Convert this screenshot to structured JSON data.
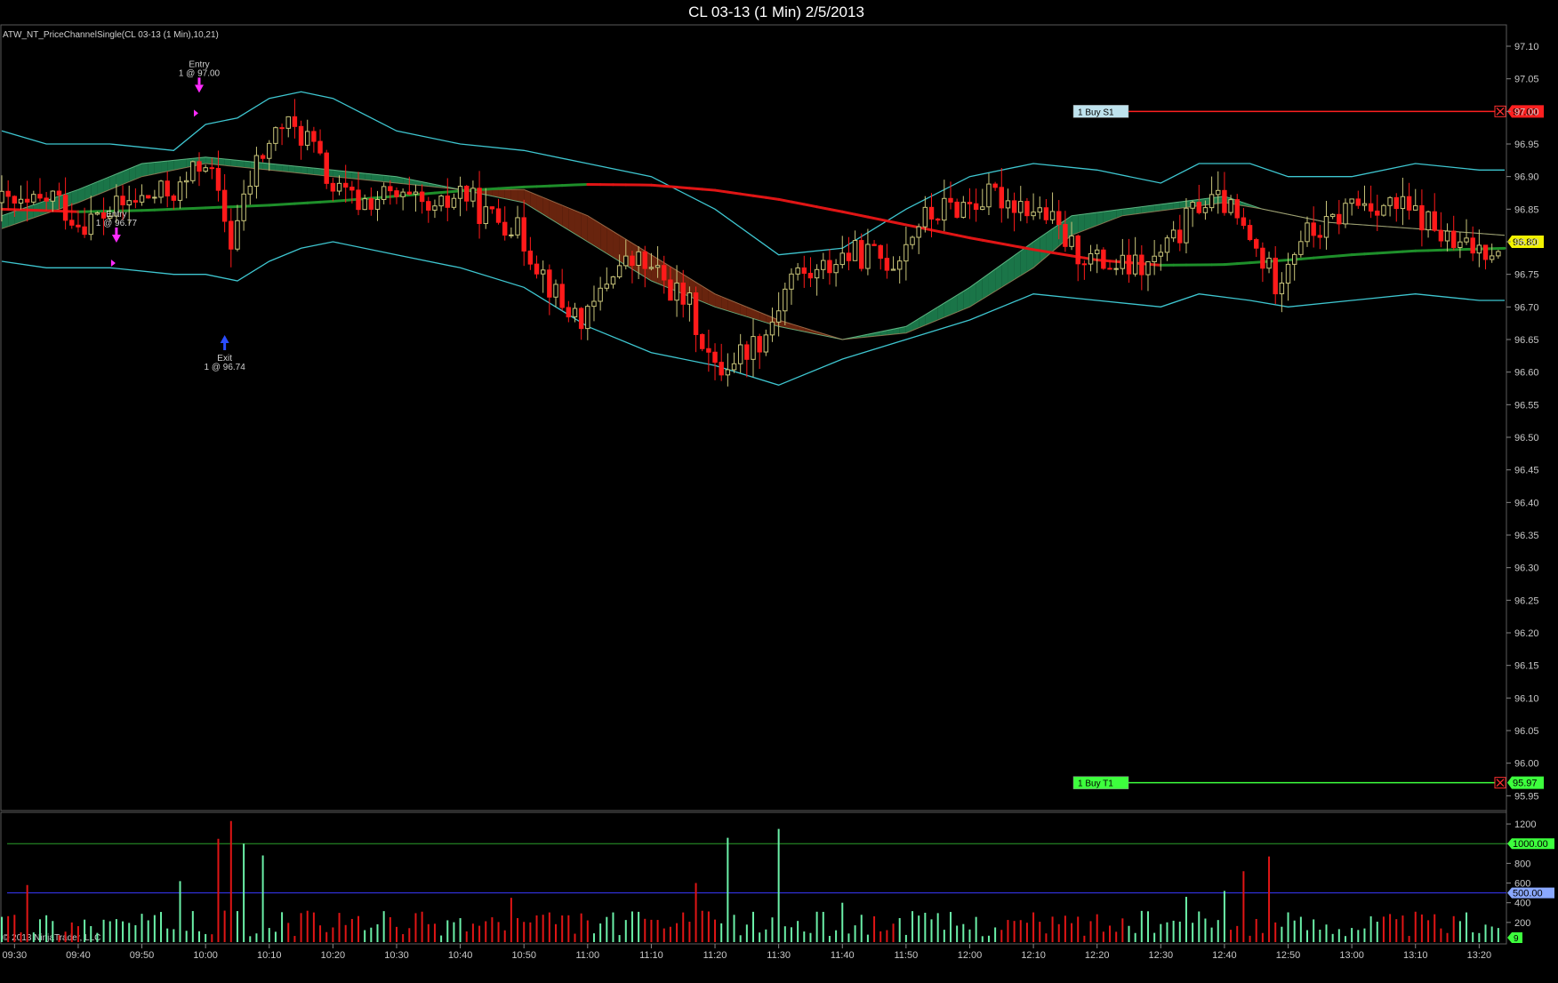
{
  "window": {
    "title": "CL 03-13 (1 Min)  2/5/2013",
    "indicator_label": "ATW_NT_PriceChannelSingle(CL 03-13 (1 Min),10,21)",
    "copyright": "© 2013 NinjaTrader, LLC"
  },
  "colors": {
    "background": "#000000",
    "up_candle": "#c8c47a",
    "down_candle": "#ff1a1a",
    "channel": "#3ec6d0",
    "ma_slow_up": "#1e8f2a",
    "ma_slow_down": "#e01515",
    "cloud_bull": "#1e8a55",
    "cloud_bear": "#7a2a10",
    "volume_up": "#6bf0a8",
    "volume_down": "#e01515",
    "stop_line": "#ff2020",
    "target_line": "#3dff3d"
  },
  "orders": {
    "stop_label": "1   Buy S1",
    "stop_price_label": "97.00",
    "target_label": "1   Buy T1",
    "target_price_label": "95.97",
    "last_price_label": "96.80"
  },
  "trades": {
    "entry1_title": "Entry",
    "entry1_detail": "1 @ 96.77",
    "entry2_title": "Entry",
    "entry2_detail": "1 @ 97.00",
    "exit_title": "Exit",
    "exit_detail": "1 @ 96.74"
  },
  "volume_panel": {
    "level_high_label": "1000.00",
    "level_mid_label": "500.00",
    "last_volume_label": "9"
  },
  "chart_data": [
    {
      "type": "candlestick",
      "title": "CL 03-13 (1 Min)  2/5/2013",
      "ylim": [
        95.93,
        97.13
      ],
      "yticks": [
        "97.10",
        "97.05",
        "97.00",
        "96.95",
        "96.90",
        "96.85",
        "96.80",
        "96.75",
        "96.70",
        "96.65",
        "96.60",
        "96.55",
        "96.50",
        "96.45",
        "96.40",
        "96.35",
        "96.30",
        "96.25",
        "96.20",
        "96.15",
        "96.10",
        "96.05",
        "96.00",
        "95.95"
      ],
      "ytick_values": [
        97.1,
        97.05,
        97.0,
        96.95,
        96.9,
        96.85,
        96.8,
        96.75,
        96.7,
        96.65,
        96.6,
        96.55,
        96.5,
        96.45,
        96.4,
        96.35,
        96.3,
        96.25,
        96.2,
        96.15,
        96.1,
        96.05,
        96.0,
        95.95
      ],
      "x_range_minutes": [
        568,
        804
      ],
      "xticks": [
        "09:30",
        "09:40",
        "09:50",
        "10:00",
        "10:10",
        "10:20",
        "10:30",
        "10:40",
        "10:50",
        "11:00",
        "11:10",
        "11:20",
        "11:30",
        "11:40",
        "11:50",
        "12:00",
        "12:10",
        "12:20",
        "12:30",
        "12:40",
        "12:50",
        "13:00",
        "13:10",
        "13:20"
      ],
      "xtick_minutes": [
        570,
        580,
        590,
        600,
        610,
        620,
        630,
        640,
        650,
        660,
        670,
        680,
        690,
        700,
        710,
        720,
        730,
        740,
        750,
        760,
        770,
        780,
        790,
        800
      ],
      "close_path": [
        [
          568,
          96.86
        ],
        [
          572,
          96.85
        ],
        [
          576,
          96.87
        ],
        [
          580,
          96.83
        ],
        [
          584,
          96.84
        ],
        [
          588,
          96.86
        ],
        [
          592,
          96.87
        ],
        [
          596,
          96.88
        ],
        [
          600,
          96.93
        ],
        [
          604,
          96.8
        ],
        [
          608,
          96.92
        ],
        [
          612,
          96.98
        ],
        [
          616,
          96.96
        ],
        [
          620,
          96.88
        ],
        [
          624,
          96.86
        ],
        [
          628,
          96.87
        ],
        [
          632,
          96.86
        ],
        [
          636,
          96.84
        ],
        [
          640,
          96.88
        ],
        [
          644,
          96.84
        ],
        [
          648,
          96.83
        ],
        [
          652,
          96.77
        ],
        [
          656,
          96.7
        ],
        [
          660,
          96.68
        ],
        [
          664,
          96.76
        ],
        [
          668,
          96.77
        ],
        [
          672,
          96.74
        ],
        [
          676,
          96.7
        ],
        [
          680,
          96.6
        ],
        [
          684,
          96.63
        ],
        [
          688,
          96.66
        ],
        [
          692,
          96.75
        ],
        [
          696,
          96.75
        ],
        [
          700,
          96.78
        ],
        [
          704,
          96.78
        ],
        [
          708,
          96.77
        ],
        [
          712,
          96.83
        ],
        [
          716,
          96.85
        ],
        [
          720,
          96.86
        ],
        [
          724,
          96.87
        ],
        [
          728,
          96.86
        ],
        [
          732,
          96.84
        ],
        [
          736,
          96.79
        ],
        [
          740,
          96.77
        ],
        [
          744,
          96.76
        ],
        [
          748,
          96.76
        ],
        [
          752,
          96.8
        ],
        [
          756,
          96.86
        ],
        [
          760,
          96.86
        ],
        [
          764,
          96.8
        ],
        [
          768,
          96.74
        ],
        [
          772,
          96.81
        ],
        [
          776,
          96.82
        ],
        [
          780,
          96.86
        ],
        [
          784,
          96.86
        ],
        [
          788,
          96.85
        ],
        [
          792,
          96.83
        ],
        [
          796,
          96.79
        ],
        [
          800,
          96.79
        ],
        [
          804,
          96.8
        ]
      ],
      "ma_fast": [
        [
          568,
          96.84
        ],
        [
          580,
          96.88
        ],
        [
          590,
          96.92
        ],
        [
          600,
          96.93
        ],
        [
          610,
          96.92
        ],
        [
          620,
          96.91
        ],
        [
          630,
          96.9
        ],
        [
          640,
          96.88
        ],
        [
          650,
          96.86
        ],
        [
          660,
          96.8
        ],
        [
          670,
          96.74
        ],
        [
          680,
          96.7
        ],
        [
          690,
          96.67
        ],
        [
          700,
          96.65
        ],
        [
          710,
          96.67
        ],
        [
          720,
          96.73
        ],
        [
          730,
          96.8
        ],
        [
          736,
          96.84
        ],
        [
          744,
          96.85
        ],
        [
          752,
          96.86
        ],
        [
          760,
          96.87
        ],
        [
          766,
          96.85
        ],
        [
          776,
          96.83
        ],
        [
          790,
          96.82
        ],
        [
          804,
          96.81
        ]
      ],
      "ma_mid": [
        [
          568,
          96.82
        ],
        [
          580,
          96.86
        ],
        [
          590,
          96.9
        ],
        [
          600,
          96.92
        ],
        [
          610,
          96.91
        ],
        [
          620,
          96.9
        ],
        [
          630,
          96.89
        ],
        [
          640,
          96.88
        ],
        [
          650,
          96.88
        ],
        [
          660,
          96.84
        ],
        [
          670,
          96.78
        ],
        [
          680,
          96.72
        ],
        [
          690,
          96.68
        ],
        [
          700,
          96.65
        ],
        [
          710,
          96.66
        ],
        [
          720,
          96.7
        ],
        [
          730,
          96.76
        ],
        [
          736,
          96.81
        ],
        [
          744,
          96.84
        ],
        [
          752,
          96.85
        ],
        [
          760,
          96.86
        ],
        [
          766,
          96.85
        ],
        [
          776,
          96.83
        ],
        [
          790,
          96.82
        ],
        [
          804,
          96.81
        ]
      ],
      "ma_slow": [
        [
          568,
          96.85
        ],
        [
          580,
          96.846
        ],
        [
          590,
          96.848
        ],
        [
          600,
          96.852
        ],
        [
          610,
          96.856
        ],
        [
          620,
          96.862
        ],
        [
          630,
          96.87
        ],
        [
          640,
          96.878
        ],
        [
          650,
          96.884
        ],
        [
          660,
          96.888
        ],
        [
          670,
          96.887
        ],
        [
          680,
          96.879
        ],
        [
          690,
          96.865
        ],
        [
          700,
          96.846
        ],
        [
          710,
          96.826
        ],
        [
          720,
          96.806
        ],
        [
          730,
          96.788
        ],
        [
          740,
          96.772
        ],
        [
          750,
          96.764
        ],
        [
          760,
          96.765
        ],
        [
          770,
          96.772
        ],
        [
          780,
          96.78
        ],
        [
          790,
          96.786
        ],
        [
          800,
          96.789
        ],
        [
          804,
          96.79
        ]
      ],
      "channel_upper": [
        [
          568,
          96.97
        ],
        [
          575,
          96.95
        ],
        [
          585,
          96.95
        ],
        [
          595,
          96.94
        ],
        [
          600,
          96.98
        ],
        [
          605,
          96.99
        ],
        [
          610,
          97.02
        ],
        [
          615,
          97.03
        ],
        [
          620,
          97.02
        ],
        [
          630,
          96.97
        ],
        [
          640,
          96.95
        ],
        [
          650,
          96.94
        ],
        [
          660,
          96.92
        ],
        [
          670,
          96.9
        ],
        [
          680,
          96.85
        ],
        [
          690,
          96.78
        ],
        [
          700,
          96.79
        ],
        [
          710,
          96.85
        ],
        [
          720,
          96.9
        ],
        [
          730,
          96.92
        ],
        [
          740,
          96.91
        ],
        [
          750,
          96.89
        ],
        [
          756,
          96.92
        ],
        [
          764,
          96.92
        ],
        [
          770,
          96.9
        ],
        [
          780,
          96.9
        ],
        [
          790,
          96.92
        ],
        [
          800,
          96.91
        ],
        [
          804,
          96.91
        ]
      ],
      "channel_lower": [
        [
          568,
          96.77
        ],
        [
          575,
          96.76
        ],
        [
          585,
          96.76
        ],
        [
          595,
          96.75
        ],
        [
          600,
          96.75
        ],
        [
          605,
          96.74
        ],
        [
          610,
          96.77
        ],
        [
          615,
          96.79
        ],
        [
          620,
          96.8
        ],
        [
          630,
          96.78
        ],
        [
          640,
          96.76
        ],
        [
          650,
          96.73
        ],
        [
          660,
          96.67
        ],
        [
          670,
          96.63
        ],
        [
          680,
          96.61
        ],
        [
          690,
          96.58
        ],
        [
          700,
          96.62
        ],
        [
          710,
          96.65
        ],
        [
          720,
          96.68
        ],
        [
          730,
          96.72
        ],
        [
          740,
          96.71
        ],
        [
          750,
          96.7
        ],
        [
          756,
          96.72
        ],
        [
          764,
          96.71
        ],
        [
          770,
          96.7
        ],
        [
          780,
          96.71
        ],
        [
          790,
          96.72
        ],
        [
          800,
          96.71
        ],
        [
          804,
          96.71
        ]
      ],
      "stop_price": 97.0,
      "target_price": 95.97,
      "last_price": 96.8,
      "trades": [
        {
          "type": "entry",
          "minute": 586,
          "price": 96.77
        },
        {
          "type": "entry",
          "minute": 599,
          "price": 97.0
        },
        {
          "type": "exit",
          "minute": 603,
          "price": 96.74
        }
      ]
    },
    {
      "type": "bar",
      "title": "Volume",
      "ylim": [
        0,
        1300
      ],
      "yticks": [
        "1200",
        "1000",
        "800",
        "600",
        "400",
        "200"
      ],
      "ytick_values": [
        1200,
        1000,
        800,
        600,
        400,
        200
      ],
      "level_lines": [
        1000,
        500
      ],
      "last_value": 9,
      "spikes": [
        {
          "minute": 572,
          "value": 580
        },
        {
          "minute": 596,
          "value": 620
        },
        {
          "minute": 602,
          "value": 1050
        },
        {
          "minute": 604,
          "value": 1230
        },
        {
          "minute": 606,
          "value": 1000
        },
        {
          "minute": 609,
          "value": 880
        },
        {
          "minute": 648,
          "value": 450
        },
        {
          "minute": 677,
          "value": 600
        },
        {
          "minute": 682,
          "value": 1060
        },
        {
          "minute": 690,
          "value": 1150
        },
        {
          "minute": 763,
          "value": 720
        },
        {
          "minute": 767,
          "value": 870
        },
        {
          "minute": 760,
          "value": 520
        },
        {
          "minute": 754,
          "value": 460
        },
        {
          "minute": 700,
          "value": 400
        }
      ]
    }
  ]
}
